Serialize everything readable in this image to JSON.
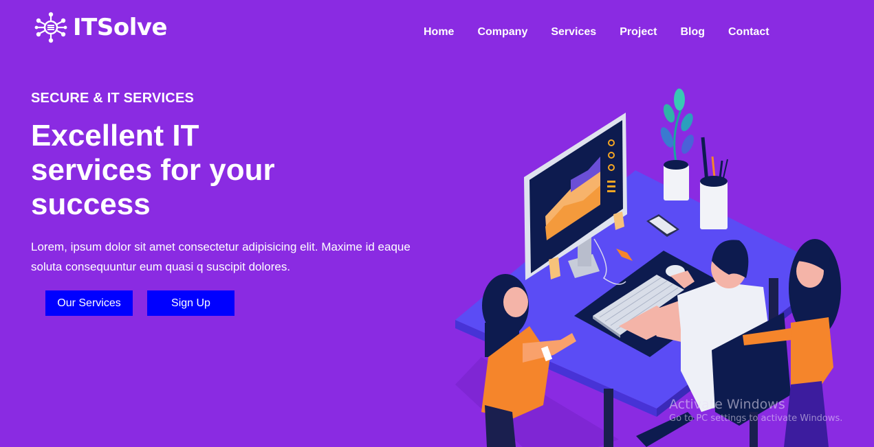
{
  "brand": {
    "name": "ITSolve",
    "logo_icon": "network-hub-icon"
  },
  "nav": {
    "items": [
      {
        "label": "Home"
      },
      {
        "label": "Company"
      },
      {
        "label": "Services"
      },
      {
        "label": "Project"
      },
      {
        "label": "Blog"
      },
      {
        "label": "Contact"
      }
    ]
  },
  "hero": {
    "eyebrow": "SECURE & IT SERVICES",
    "headline": "Excellent IT services for your success",
    "lede": "Lorem, ipsum dolor sit amet consectetur adipisicing elit. Maxime id eaque soluta consequuntur eum quasi q suscipit dolores.",
    "primary_button": "Our Services",
    "secondary_button": "Sign Up"
  },
  "watermark": {
    "title": "Activate Windows",
    "subtitle": "Go to PC settings to activate Windows."
  },
  "colors": {
    "background": "#8a2be2",
    "button": "#0000ff",
    "desk": "#5b4cf5",
    "accent_orange": "#f5852b",
    "navy": "#0d1b4f"
  }
}
